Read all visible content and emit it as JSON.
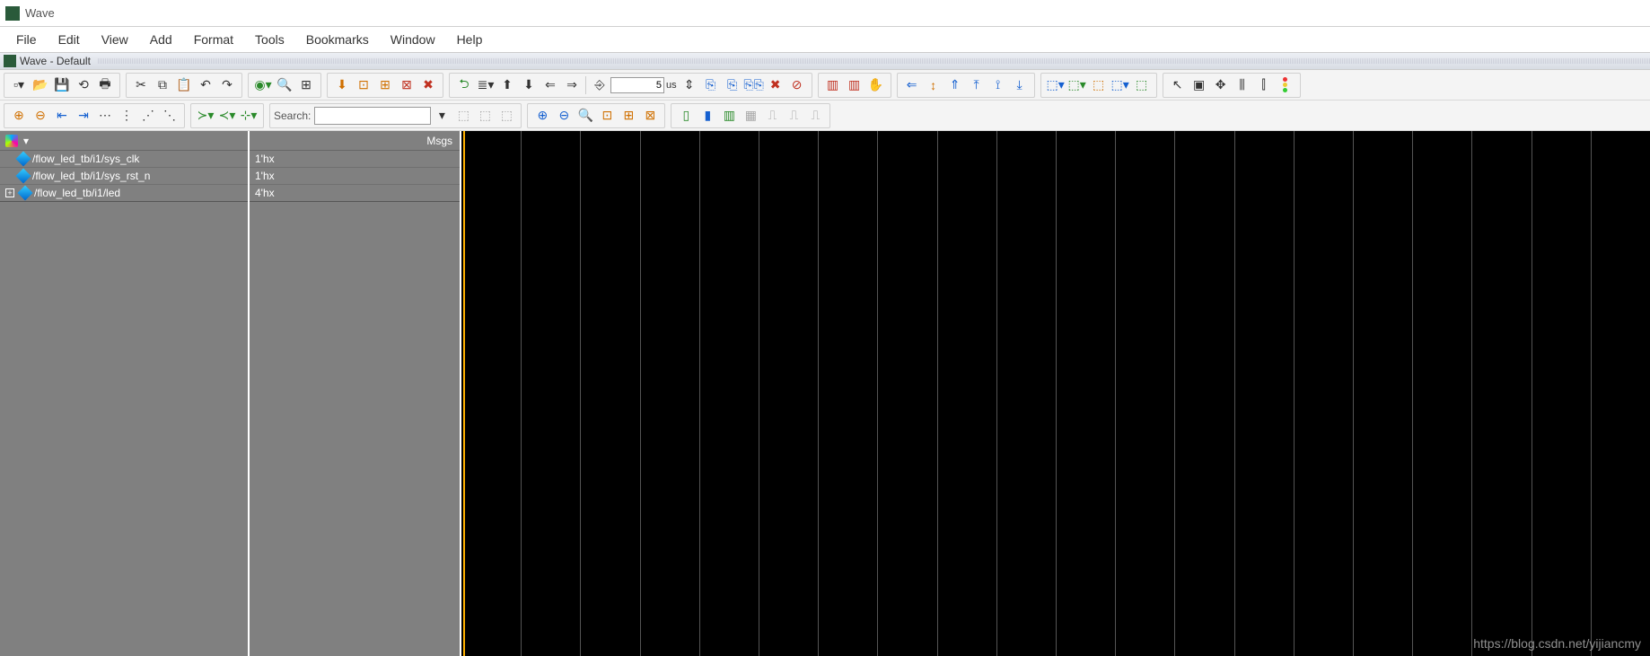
{
  "window": {
    "title": "Wave"
  },
  "subtitle": {
    "text": "Wave - Default"
  },
  "menu": {
    "items": [
      "File",
      "Edit",
      "View",
      "Add",
      "Format",
      "Tools",
      "Bookmarks",
      "Window",
      "Help"
    ]
  },
  "toolbar1": {
    "run_time_value": "5",
    "run_time_unit": "us"
  },
  "toolbar2": {
    "search_label": "Search:",
    "search_value": ""
  },
  "columns": {
    "signals_header": "",
    "msgs_header": "Msgs"
  },
  "signals": [
    {
      "expandable": false,
      "name": "/flow_led_tb/i1/sys_clk",
      "value": "1'hx"
    },
    {
      "expandable": false,
      "name": "/flow_led_tb/i1/sys_rst_n",
      "value": "1'hx"
    },
    {
      "expandable": true,
      "name": "/flow_led_tb/i1/led",
      "value": "4'hx"
    }
  ],
  "wave": {
    "grid_divisions": 20
  },
  "watermark": "https://blog.csdn.net/yijiancmy"
}
